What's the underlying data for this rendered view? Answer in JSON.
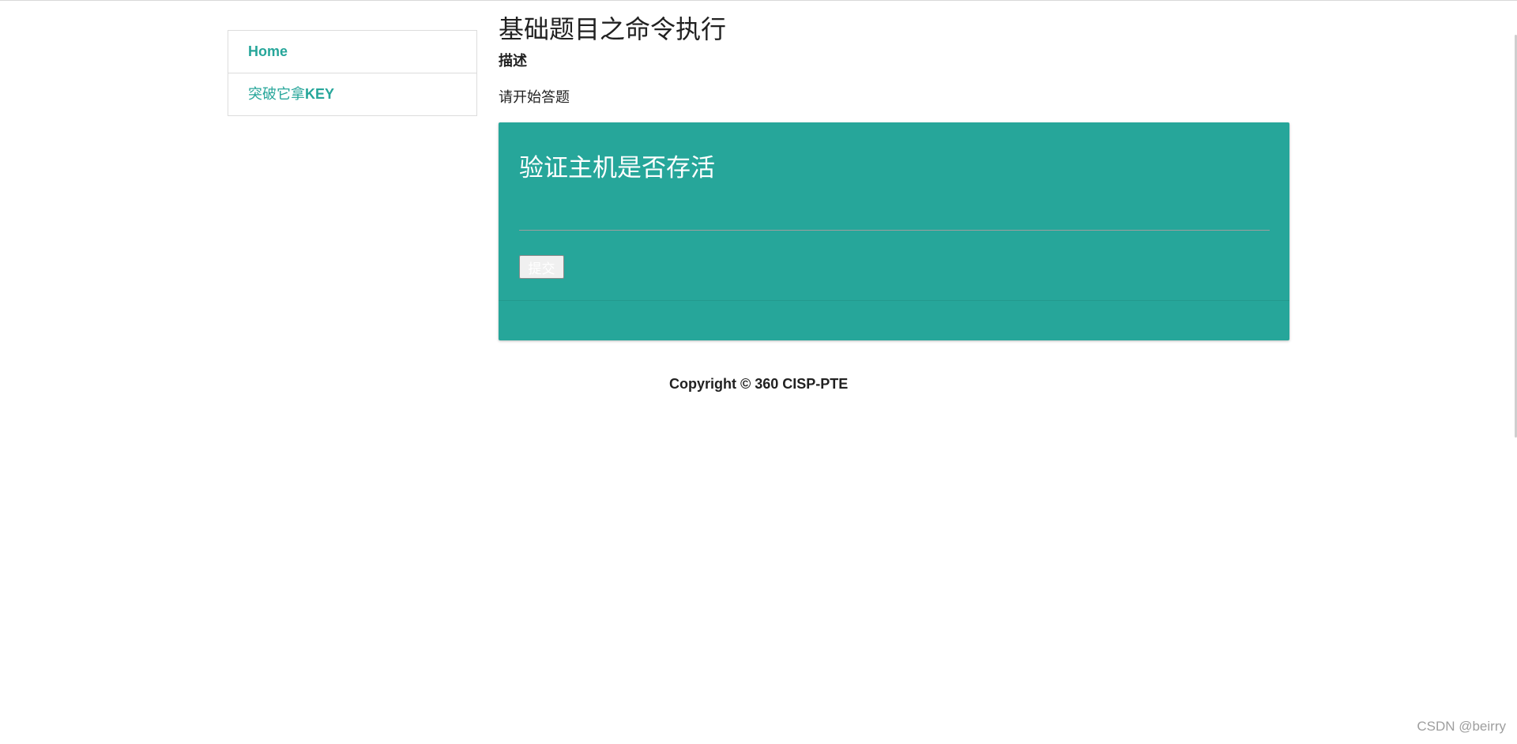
{
  "sidebar": {
    "items": [
      {
        "label": "Home"
      },
      {
        "label_prefix": "突破它拿",
        "label_bold": "KEY"
      }
    ]
  },
  "main": {
    "title": "基础题目之命令执行",
    "description_heading": "描述",
    "description_text": "请开始答题"
  },
  "card": {
    "title": "验证主机是否存活",
    "input_value": "",
    "submit_label": "提交"
  },
  "footer": {
    "copyright": "Copyright © 360 CISP-PTE"
  },
  "watermark": {
    "text": "CSDN @beirry"
  },
  "colors": {
    "accent": "#26a69a"
  }
}
